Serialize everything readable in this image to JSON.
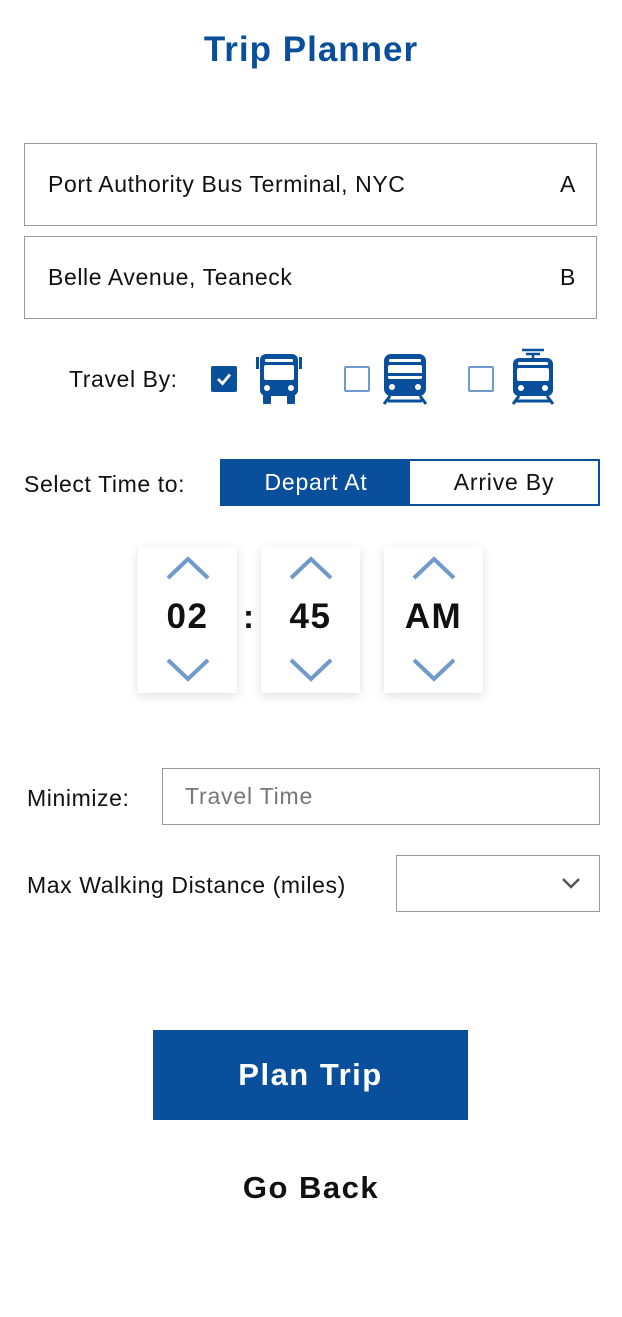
{
  "header": {
    "title": "Trip Planner"
  },
  "locations": {
    "origin": {
      "value": "Port Authority Bus Terminal, NYC",
      "marker": "A"
    },
    "destination": {
      "value": "Belle Avenue, Teaneck",
      "marker": "B"
    }
  },
  "travel_by": {
    "label": "Travel By:",
    "modes": [
      {
        "icon": "bus-icon",
        "checked": true
      },
      {
        "icon": "train-icon",
        "checked": false
      },
      {
        "icon": "light-rail-icon",
        "checked": false
      }
    ]
  },
  "time_select": {
    "label": "Select Time to:",
    "options": [
      "Depart At",
      "Arrive By"
    ],
    "selected": "Depart At"
  },
  "time": {
    "hour": "02",
    "separator": ":",
    "minute": "45",
    "period": "AM"
  },
  "minimize": {
    "label": "Minimize:",
    "placeholder": "Travel Time"
  },
  "walking": {
    "label": "Max Walking Distance (miles)",
    "value": ""
  },
  "actions": {
    "plan": "Plan Trip",
    "back": "Go Back"
  },
  "colors": {
    "brand": "#0a4f9c",
    "checkbox_border": "#6f9acb",
    "spinner_arrow": "#6f9acb"
  }
}
